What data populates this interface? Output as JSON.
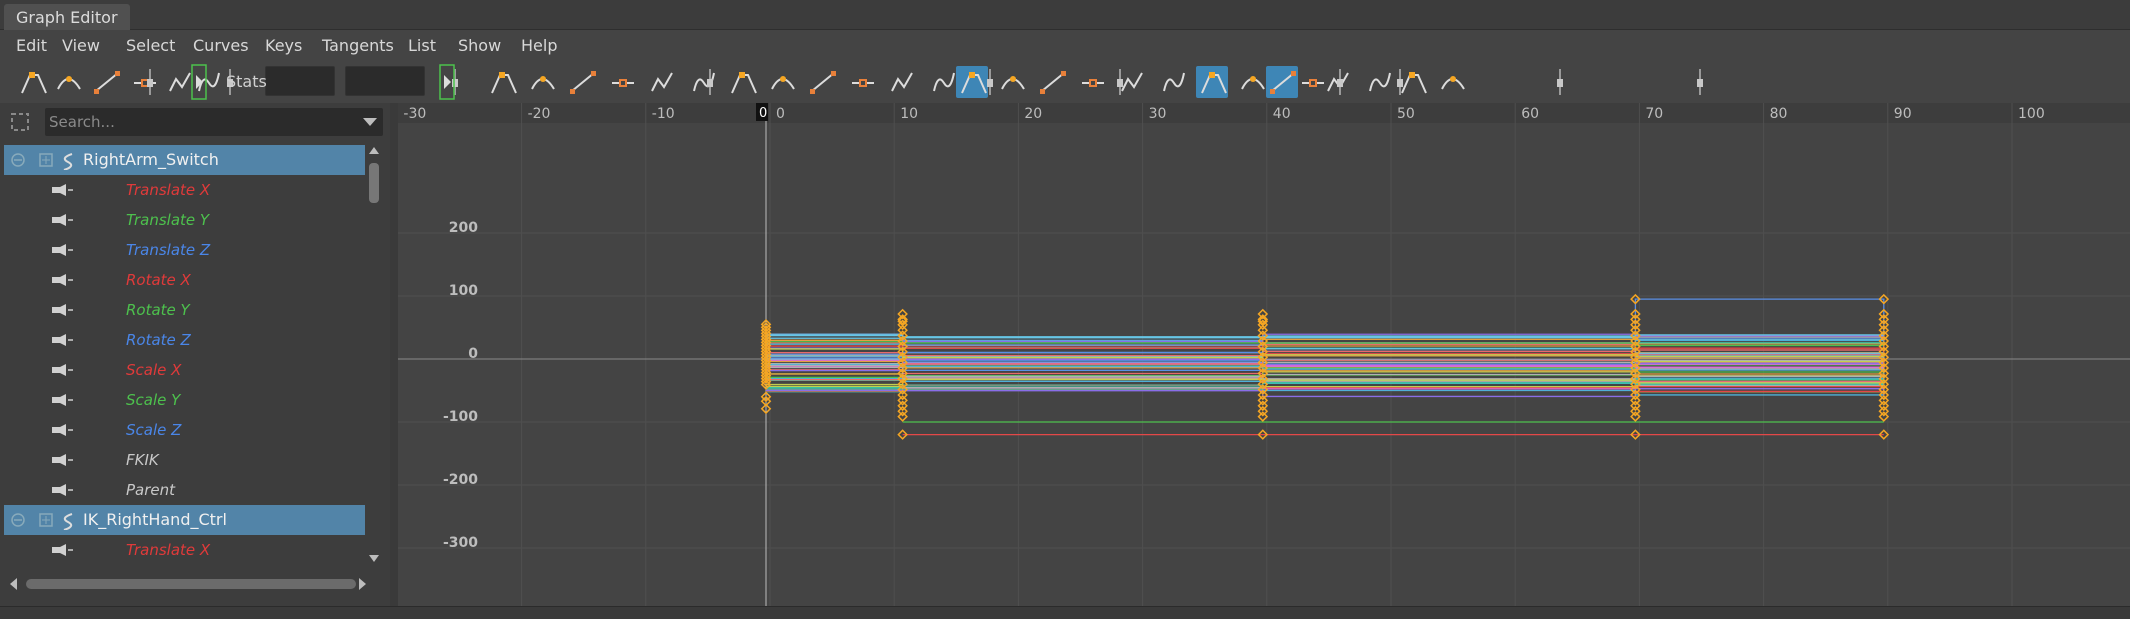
{
  "window": {
    "tab_title": "Graph Editor"
  },
  "menu": [
    "Edit",
    "View",
    "Select",
    "Curves",
    "Keys",
    "Tangents",
    "List",
    "Show",
    "Help"
  ],
  "toolbar": {
    "stats_label": "Stats",
    "stats_value_1": "",
    "stats_value_2": "",
    "icons": [
      "move-nearest-picked-key-icon",
      "insert-key-icon",
      "lattice-deform-keys-icon",
      "region-keys-icon",
      "retime-tool-icon",
      "auto-load-icon",
      "frame-all-icon",
      "frame-playback-icon",
      "center-current-time-icon",
      "auto-tangent-icon",
      "spline-tangent-icon",
      "clamped-tangent-icon",
      "linear-tangent-icon",
      "flat-tangent-icon",
      "step-tangent-icon",
      "plateau-tangent-icon",
      "in-tangent-icon",
      "out-tangent-icon",
      "buffer-curve-snapshot-icon",
      "swap-buffer-curves-icon",
      "break-tangents-icon",
      "unify-tangents-icon",
      "free-tangent-weight-icon",
      "lock-tangent-weight-icon",
      "time-snap-icon",
      "value-snap-icon",
      "normalize-icon",
      "denormalize-icon",
      "pre-infinity-cycle-icon",
      "post-infinity-cycle-icon",
      "pre-infinity-offset-icon",
      "post-infinity-offset-icon"
    ],
    "accent_active": "#3e86b6"
  },
  "outliner": {
    "search_placeholder": "Search...",
    "rows": [
      {
        "type": "node",
        "label": "RightArm_Switch",
        "selected": true
      },
      {
        "type": "attr",
        "label": "Translate X",
        "color": "red"
      },
      {
        "type": "attr",
        "label": "Translate Y",
        "color": "green"
      },
      {
        "type": "attr",
        "label": "Translate Z",
        "color": "blue"
      },
      {
        "type": "attr",
        "label": "Rotate X",
        "color": "red"
      },
      {
        "type": "attr",
        "label": "Rotate Y",
        "color": "green"
      },
      {
        "type": "attr",
        "label": "Rotate Z",
        "color": "blue"
      },
      {
        "type": "attr",
        "label": "Scale X",
        "color": "red"
      },
      {
        "type": "attr",
        "label": "Scale Y",
        "color": "green"
      },
      {
        "type": "attr",
        "label": "Scale Z",
        "color": "blue"
      },
      {
        "type": "attr",
        "label": "FKIK",
        "color": "gray"
      },
      {
        "type": "attr",
        "label": "Parent",
        "color": "gray"
      },
      {
        "type": "node",
        "label": "IK_RightHand_Ctrl",
        "selected": true
      },
      {
        "type": "attr",
        "label": "Translate X",
        "color": "red"
      }
    ]
  },
  "graph": {
    "current_frame": "0",
    "frame_ticks": [
      "-30",
      "-20",
      "-10",
      "0",
      "10",
      "20",
      "30",
      "40",
      "50",
      "60",
      "70",
      "80",
      "90",
      "100"
    ],
    "value_ticks": [
      "200",
      "100",
      "0",
      "-100",
      "-200",
      "-300"
    ],
    "key_frames": [
      0,
      11,
      40,
      70,
      90
    ],
    "key_color": "#f5a623"
  }
}
